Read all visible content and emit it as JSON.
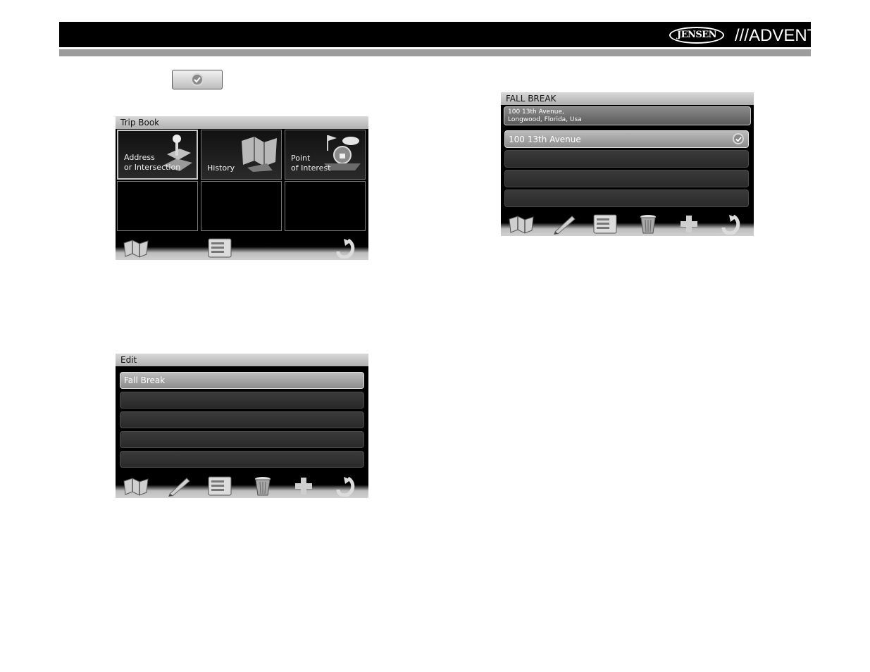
{
  "header": {
    "brand_left": "JENSEN",
    "brand_right": "///ADVENT"
  },
  "colors": {
    "header_bg": "#000000",
    "divider": "#9c9c9c",
    "screen_bg": "#000000",
    "title_bar": "#c4c4c4"
  },
  "ok_button": {
    "icon": "checkmark-icon"
  },
  "trip_book": {
    "title": "Trip Book",
    "tiles": [
      {
        "label": "Address\nor Intersection",
        "icon": "address-pin-icon"
      },
      {
        "label": "History",
        "icon": "history-map-icon"
      },
      {
        "label": "Point\nof Interest",
        "icon": "poi-icon"
      }
    ],
    "toolbar": [
      "map-icon",
      "list-icon",
      "back-arrow-icon"
    ]
  },
  "edit": {
    "title": "Edit",
    "items": [
      "Fall Break",
      "",
      "",
      "",
      ""
    ],
    "toolbar": [
      "map-icon",
      "pencil-icon",
      "list-icon",
      "trash-icon",
      "plus-icon",
      "back-arrow-icon"
    ]
  },
  "fall_break": {
    "title": "FALL BREAK",
    "address_line1": "100 13th Avenue,",
    "address_line2": "Longwood, Florida, Usa",
    "items": [
      "100 13th Avenue",
      "",
      "",
      ""
    ],
    "toolbar": [
      "map-icon",
      "pencil-icon",
      "list-icon",
      "trash-icon",
      "plus-icon",
      "back-arrow-icon"
    ]
  }
}
